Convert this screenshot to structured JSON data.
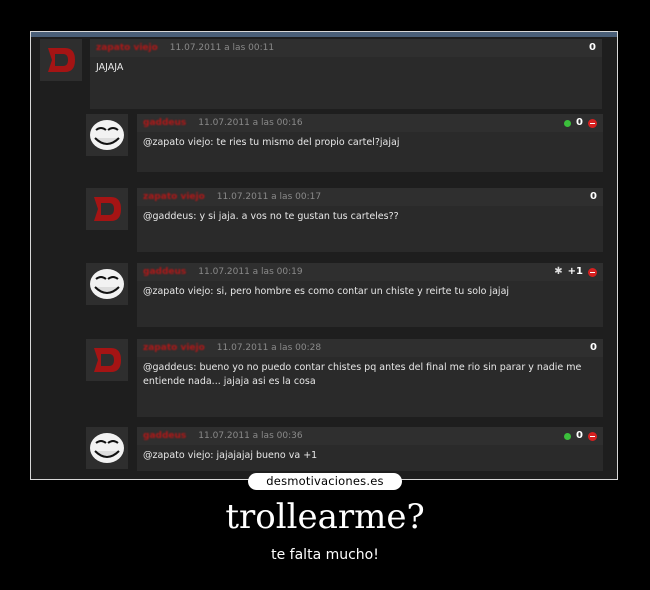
{
  "comments": [
    {
      "author": "zapato viejo",
      "date": "11.07.2011 a las 00:11",
      "text": "JAJAJA",
      "score": "0",
      "avatar": "red-d-avatar"
    },
    {
      "author": "gaddeus",
      "date": "11.07.2011 a las 00:16",
      "text": "@zapato viejo: te ries tu mismo del propio cartel?jajaj",
      "score": "0",
      "avatar": "trollface-avatar"
    },
    {
      "author": "zapato viejo",
      "date": "11.07.2011 a las 00:17",
      "text": "@gaddeus: y si jaja. a vos no te gustan tus carteles??",
      "score": "0",
      "avatar": "red-d-avatar"
    },
    {
      "author": "gaddeus",
      "date": "11.07.2011 a las 00:19",
      "text": "@zapato viejo: si, pero hombre es como contar un chiste y reirte tu solo jajaj",
      "score": "+1",
      "avatar": "trollface-avatar"
    },
    {
      "author": "zapato viejo",
      "date": "11.07.2011 a las 00:28",
      "text": "@gaddeus: bueno yo no puedo contar chistes pq antes del final me rio sin parar y nadie me entiende nada... jajaja asi es la cosa",
      "score": "0",
      "avatar": "red-d-avatar"
    },
    {
      "author": "gaddeus",
      "date": "11.07.2011 a las 00:36",
      "text": "@zapato viejo: jajajajaj bueno va +1",
      "score": "0",
      "avatar": "trollface-avatar"
    }
  ],
  "site": "desmotivaciones.es",
  "poster_title": "trollearme?",
  "poster_subtitle": "te falta mucho!",
  "colors": {
    "author": "#b11818",
    "accent_bar": "#4a5f78",
    "vote_up": "#3bbf3b",
    "vote_down": "#d62020"
  },
  "icons": [
    "red-d-avatar",
    "trollface-avatar",
    "vote-up-icon",
    "vote-down-icon",
    "star-icon"
  ]
}
